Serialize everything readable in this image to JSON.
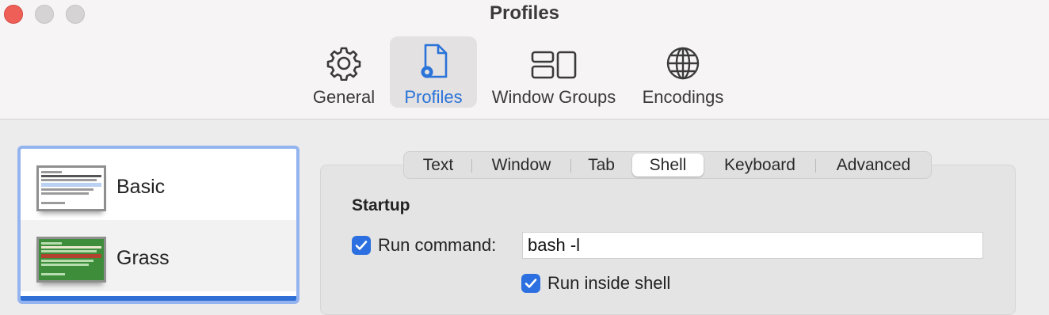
{
  "window": {
    "title": "Profiles"
  },
  "toolbar": {
    "items": [
      {
        "label": "General",
        "icon": "gear-icon"
      },
      {
        "label": "Profiles",
        "icon": "profile-document-icon"
      },
      {
        "label": "Window Groups",
        "icon": "window-groups-icon"
      },
      {
        "label": "Encodings",
        "icon": "globe-icon"
      }
    ],
    "active": "Profiles"
  },
  "profiles": {
    "items": [
      {
        "name": "Basic",
        "thumbnail": "basic-profile-thumbnail"
      },
      {
        "name": "Grass",
        "thumbnail": "grass-profile-thumbnail"
      }
    ]
  },
  "tabs": {
    "items": [
      "Text",
      "Window",
      "Tab",
      "Shell",
      "Keyboard",
      "Advanced"
    ],
    "active": "Shell"
  },
  "startup": {
    "title": "Startup",
    "run_command": {
      "label": "Run command:",
      "checked": true,
      "value": "bash -l"
    },
    "run_inside_shell": {
      "label": "Run inside shell",
      "checked": true
    }
  },
  "colors": {
    "accent": "#2c6fe0",
    "close_button": "#ee5f57",
    "grass_background": "#3d8d3b"
  }
}
